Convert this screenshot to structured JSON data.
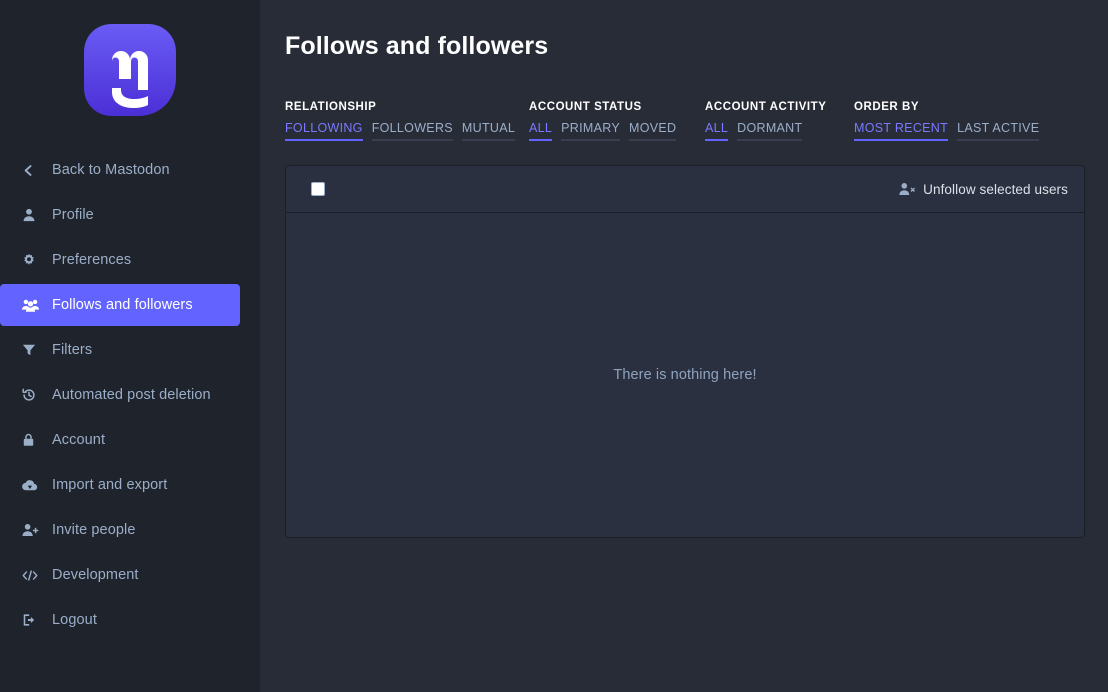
{
  "sidebar": {
    "logo_alt": "mastodon-logo",
    "items": [
      {
        "label": "Back to Mastodon",
        "icon": "chevron-left-icon",
        "id": "back-to-mastodon",
        "active": false
      },
      {
        "label": "Profile",
        "icon": "person-icon",
        "id": "profile",
        "active": false
      },
      {
        "label": "Preferences",
        "icon": "gear-icon",
        "id": "preferences",
        "active": false
      },
      {
        "label": "Follows and followers",
        "icon": "users-group-icon",
        "id": "follows-and-followers",
        "active": true
      },
      {
        "label": "Filters",
        "icon": "funnel-icon",
        "id": "filters",
        "active": false
      },
      {
        "label": "Automated post deletion",
        "icon": "history-icon",
        "id": "automated-post-deletion",
        "active": false
      },
      {
        "label": "Account",
        "icon": "lock-icon",
        "id": "account",
        "active": false
      },
      {
        "label": "Import and export",
        "icon": "cloud-download-icon",
        "id": "import-and-export",
        "active": false
      },
      {
        "label": "Invite people",
        "icon": "person-plus-icon",
        "id": "invite-people",
        "active": false
      },
      {
        "label": "Development",
        "icon": "code-icon",
        "id": "development",
        "active": false
      },
      {
        "label": "Logout",
        "icon": "logout-icon",
        "id": "logout",
        "active": false
      }
    ]
  },
  "main": {
    "page_title": "Follows and followers",
    "filters": [
      {
        "title": "RELATIONSHIP",
        "options": [
          {
            "label": "FOLLOWING",
            "active": true
          },
          {
            "label": "FOLLOWERS",
            "active": false
          },
          {
            "label": "MUTUAL",
            "active": false
          }
        ]
      },
      {
        "title": "ACCOUNT STATUS",
        "options": [
          {
            "label": "ALL",
            "active": true
          },
          {
            "label": "PRIMARY",
            "active": false
          },
          {
            "label": "MOVED",
            "active": false
          }
        ]
      },
      {
        "title": "ACCOUNT ACTIVITY",
        "options": [
          {
            "label": "ALL",
            "active": true
          },
          {
            "label": "DORMANT",
            "active": false
          }
        ]
      },
      {
        "title": "ORDER BY",
        "options": [
          {
            "label": "MOST RECENT",
            "active": true
          },
          {
            "label": "LAST ACTIVE",
            "active": false
          }
        ]
      }
    ],
    "panel": {
      "select_all_checked": false,
      "unfollow_label": "Unfollow selected users",
      "unfollow_icon": "user-remove-icon",
      "empty_message": "There is nothing here!"
    }
  },
  "colors": {
    "accent": "#6364ff",
    "accent_text": "#7b79ff",
    "page_background": "#1f232b",
    "main_background": "#282c37",
    "panel_background": "#2b3040",
    "muted_text": "#9baec8"
  }
}
